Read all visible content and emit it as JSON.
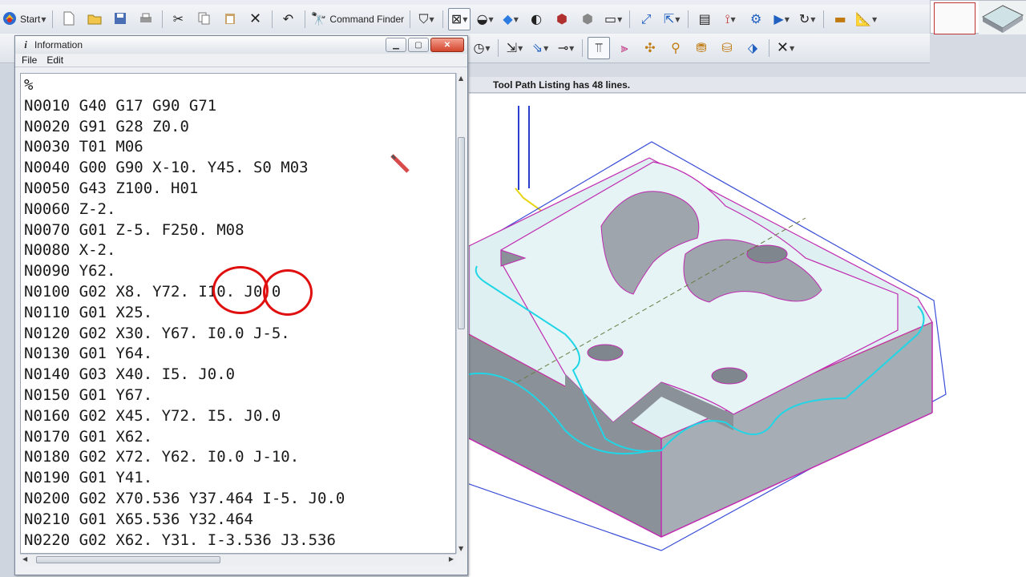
{
  "toolbar": {
    "start_label": "Start",
    "command_finder_label": "Command Finder"
  },
  "status": {
    "text": "Tool Path Listing has 48 lines."
  },
  "info_window": {
    "title": "Information",
    "menu": [
      {
        "label": "File"
      },
      {
        "label": "Edit"
      }
    ],
    "lines": [
      "%",
      "N0010 G40 G17 G90 G71",
      "N0020 G91 G28 Z0.0",
      "N0030 T01 M06",
      "N0040 G00 G90 X-10. Y45. S0 M03",
      "N0050 G43 Z100. H01",
      "N0060 Z-2.",
      "N0070 G01 Z-5. F250. M08",
      "N0080 X-2.",
      "N0090 Y62.",
      "N0100 G02 X8. Y72. I10. J0.0",
      "N0110 G01 X25.",
      "N0120 G02 X30. Y67. I0.0 J-5.",
      "N0130 G01 Y64.",
      "N0140 G03 X40. I5. J0.0",
      "N0150 G01 Y67.",
      "N0160 G02 X45. Y72. I5. J0.0",
      "N0170 G01 X62.",
      "N0180 G02 X72. Y62. I0.0 J-10.",
      "N0190 G01 Y41.",
      "N0200 G02 X70.536 Y37.464 I-5. J0.0",
      "N0210 G01 X65.536 Y32.464",
      "N0220 G02 X62. Y31. I-3.536 J3.536"
    ]
  },
  "colors": {
    "annotation": "#e01010",
    "part_face": "#dff0f2",
    "part_side": "#8c939c",
    "outline": "#3b4fd8",
    "tool_path": "#20d6e6",
    "part_edge": "#c02ab0"
  },
  "icons": [
    "start-icon",
    "new-file-icon",
    "open-folder-icon",
    "save-icon",
    "print-icon",
    "cut-icon",
    "copy-icon",
    "paste-icon",
    "delete-icon",
    "undo-icon",
    "command-finder-icon"
  ]
}
